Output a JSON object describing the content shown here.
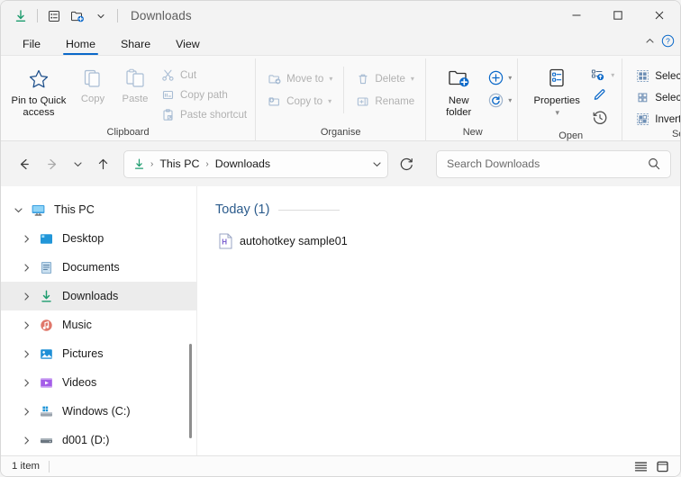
{
  "window": {
    "title": "Downloads",
    "controls": {
      "minimize": "minimize-icon",
      "maximize": "maximize-icon",
      "close": "close-icon"
    },
    "quick_access_icons": [
      "downloads-icon",
      "details-view-icon",
      "new-folder-icon",
      "chevron-down-icon"
    ]
  },
  "tabs": {
    "items": [
      {
        "label": "File",
        "active": false
      },
      {
        "label": "Home",
        "active": true
      },
      {
        "label": "Share",
        "active": false
      },
      {
        "label": "View",
        "active": false
      }
    ],
    "collapse_icon": "chevron-up-icon",
    "help_icon": "help-icon"
  },
  "ribbon": {
    "groups": [
      {
        "name": "Clipboard",
        "label": "Clipboard",
        "big": [
          {
            "label": "Pin to Quick\naccess",
            "line1": "Pin to Quick",
            "line2": "access",
            "icon": "star-icon",
            "disabled": false
          },
          {
            "label": "Copy",
            "icon": "copy-icon",
            "disabled": true
          },
          {
            "label": "Paste",
            "icon": "paste-icon",
            "disabled": true
          }
        ],
        "small": [
          {
            "label": "Cut",
            "icon": "scissors-icon",
            "disabled": true
          },
          {
            "label": "Copy path",
            "icon": "copy-path-icon",
            "disabled": true
          },
          {
            "label": "Paste shortcut",
            "icon": "paste-shortcut-icon",
            "disabled": true
          }
        ]
      },
      {
        "name": "Organise",
        "label": "Organise",
        "small_a": [
          {
            "label": "Move to",
            "icon": "move-to-icon",
            "disabled": true,
            "dropdown": true
          },
          {
            "label": "Copy to",
            "icon": "copy-to-icon",
            "disabled": true,
            "dropdown": true
          }
        ],
        "small_b": [
          {
            "label": "Delete",
            "icon": "trash-icon",
            "disabled": true,
            "dropdown": true
          },
          {
            "label": "Rename",
            "icon": "rename-icon",
            "disabled": true,
            "dropdown": false
          }
        ]
      },
      {
        "name": "New",
        "label": "New",
        "big": [
          {
            "line1": "New",
            "line2": "folder",
            "icon": "new-folder-icon",
            "disabled": false
          }
        ],
        "stack": [
          {
            "name": "new-item",
            "icon": "plus-circle-icon",
            "dropdown": true
          },
          {
            "name": "easy-access",
            "icon": "refresh-circle-icon",
            "dropdown": true
          }
        ]
      },
      {
        "name": "Open",
        "label": "Open",
        "big": [
          {
            "line1": "Properties",
            "icon": "properties-icon",
            "dropdown": true,
            "disabled": false
          }
        ],
        "stack": [
          {
            "name": "open-with",
            "icon": "open-icon",
            "dropdown": true
          },
          {
            "name": "edit",
            "icon": "pencil-icon",
            "dropdown": false
          },
          {
            "name": "history",
            "icon": "history-icon",
            "dropdown": false
          }
        ]
      },
      {
        "name": "Select",
        "label": "Select",
        "small": [
          {
            "label": "Select all",
            "icon": "select-all-icon",
            "disabled": false
          },
          {
            "label": "Select none",
            "icon": "select-none-icon",
            "disabled": false
          },
          {
            "label": "Invert selection",
            "icon": "invert-selection-icon",
            "disabled": false
          }
        ]
      }
    ]
  },
  "addressbar": {
    "back_icon": "arrow-left-icon",
    "forward_icon": "arrow-right-icon",
    "recent_icon": "chevron-down-icon",
    "up_icon": "arrow-up-icon",
    "path_icon": "downloads-icon",
    "crumbs": [
      "This PC",
      "Downloads"
    ],
    "separator": "›",
    "dropdown_icon": "chevron-down-icon",
    "refresh_icon": "refresh-icon",
    "search": {
      "placeholder": "Search Downloads",
      "value": "",
      "icon": "search-icon"
    }
  },
  "sidebar": {
    "items": [
      {
        "label": "This PC",
        "icon": "this-pc-icon",
        "expanded": true,
        "selected": false,
        "indent": false
      },
      {
        "label": "Desktop",
        "icon": "desktop-icon",
        "expanded": false,
        "selected": false,
        "indent": true
      },
      {
        "label": "Documents",
        "icon": "documents-icon",
        "expanded": false,
        "selected": false,
        "indent": true
      },
      {
        "label": "Downloads",
        "icon": "downloads-icon",
        "expanded": false,
        "selected": true,
        "indent": true
      },
      {
        "label": "Music",
        "icon": "music-icon",
        "expanded": false,
        "selected": false,
        "indent": true
      },
      {
        "label": "Pictures",
        "icon": "pictures-icon",
        "expanded": false,
        "selected": false,
        "indent": true
      },
      {
        "label": "Videos",
        "icon": "videos-icon",
        "expanded": false,
        "selected": false,
        "indent": true
      },
      {
        "label": "Windows (C:)",
        "icon": "drive-windows-icon",
        "expanded": false,
        "selected": false,
        "indent": true
      },
      {
        "label": "d001 (D:)",
        "icon": "drive-icon",
        "expanded": false,
        "selected": false,
        "indent": true
      }
    ]
  },
  "content": {
    "group_header": "Today (1)",
    "files": [
      {
        "name": "autohotkey sample01",
        "icon": "autohotkey-file-icon",
        "icon_letter": "H"
      }
    ]
  },
  "statusbar": {
    "item_count": "1 item",
    "details_view_icon": "details-view-icon",
    "large_icons_view_icon": "large-icons-view-icon"
  },
  "colors": {
    "accent": "#0a68c9",
    "group_header": "#2b5b8c",
    "downloads_green": "#1d9c6e",
    "selection": "#ececec",
    "disabled": "#b1b1b1"
  }
}
